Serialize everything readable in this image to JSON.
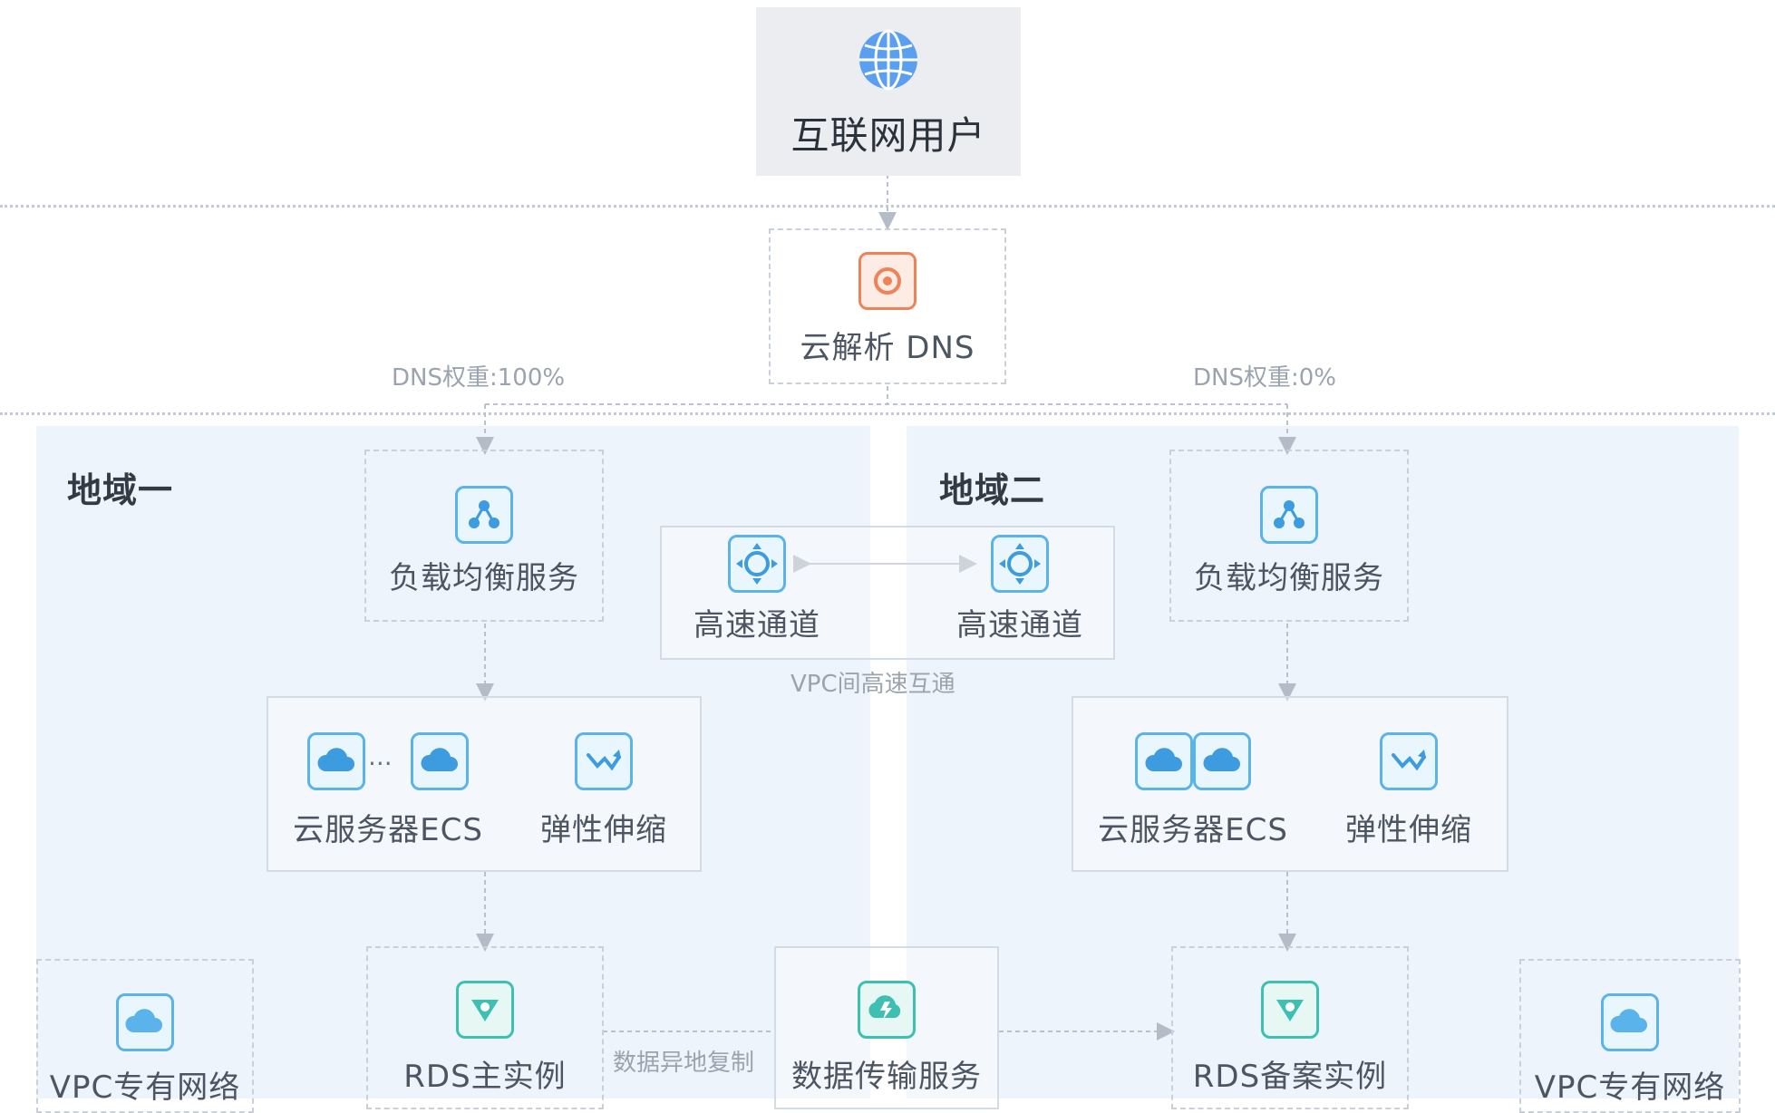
{
  "internet_users": {
    "label": "互联网用户",
    "icon": "globe-icon"
  },
  "dns": {
    "label": "云解析 DNS",
    "icon": "dns-icon"
  },
  "edges": {
    "dns_weight_left": "DNS权重:100%",
    "dns_weight_right": "DNS权重:0%",
    "vpc_peering": "VPC间高速互通",
    "data_sync": "数据异地复制"
  },
  "regions": {
    "region_1": "地域一",
    "region_2": "地域二"
  },
  "left": {
    "slb": "负载均衡服务",
    "ecs": "云服务器ECS",
    "autoscaling": "弹性伸缩",
    "rds": "RDS主实例",
    "vpc": "VPC专有网络"
  },
  "right": {
    "slb": "负载均衡服务",
    "ecs": "云服务器ECS",
    "autoscaling": "弹性伸缩",
    "rds": "RDS备案实例",
    "vpc": "VPC专有网络"
  },
  "center": {
    "channel_a": "高速通道",
    "channel_b": "高速通道",
    "dts": "数据传输服务"
  },
  "ellipsis": "···",
  "colors": {
    "accent_blue": "#5ab3ea",
    "accent_teal": "#3dbfb1",
    "accent_orange": "#ef8258",
    "region_bg": "#eef4fb"
  }
}
